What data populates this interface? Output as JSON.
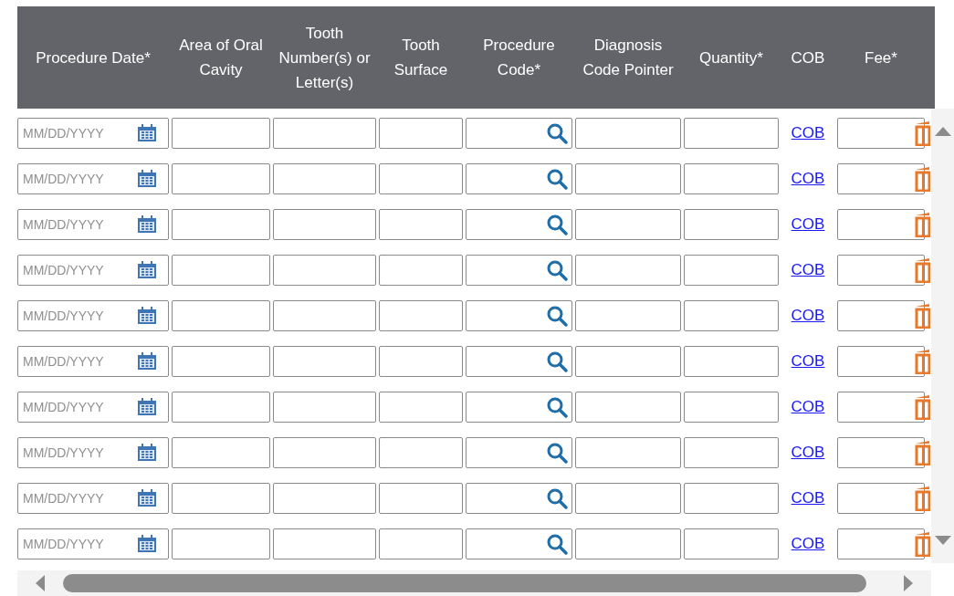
{
  "table": {
    "columns": [
      "Procedure Date*",
      "Area of Oral Cavity",
      "Tooth Number(s) or Letter(s)",
      "Tooth Surface",
      "Procedure Code*",
      "Diagnosis Code Pointer",
      "Quantity*",
      "COB",
      "Fee*"
    ],
    "rows": [
      {
        "date_placeholder": "MM/DD/YYYY",
        "cob_link": "COB"
      },
      {
        "date_placeholder": "MM/DD/YYYY",
        "cob_link": "COB"
      },
      {
        "date_placeholder": "MM/DD/YYYY",
        "cob_link": "COB"
      },
      {
        "date_placeholder": "MM/DD/YYYY",
        "cob_link": "COB"
      },
      {
        "date_placeholder": "MM/DD/YYYY",
        "cob_link": "COB"
      },
      {
        "date_placeholder": "MM/DD/YYYY",
        "cob_link": "COB"
      },
      {
        "date_placeholder": "MM/DD/YYYY",
        "cob_link": "COB"
      },
      {
        "date_placeholder": "MM/DD/YYYY",
        "cob_link": "COB"
      },
      {
        "date_placeholder": "MM/DD/YYYY",
        "cob_link": "COB"
      },
      {
        "date_placeholder": "MM/DD/YYYY",
        "cob_link": "COB"
      }
    ]
  }
}
